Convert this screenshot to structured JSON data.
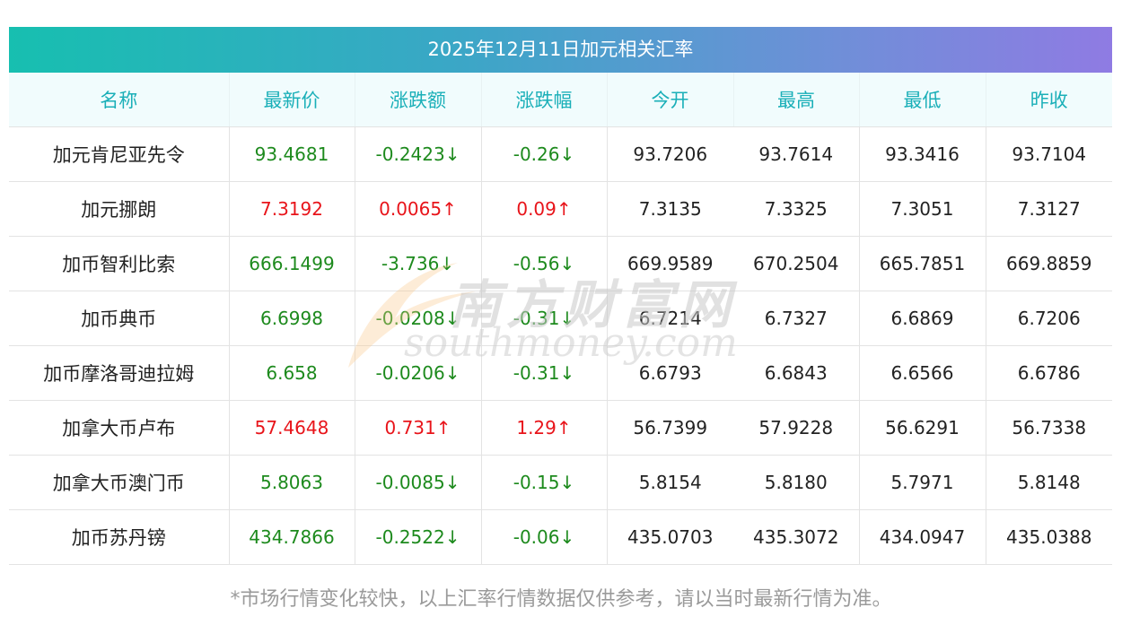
{
  "table": {
    "title": "2025年12月11日加元相关汇率",
    "headers": [
      "名称",
      "最新价",
      "涨跌额",
      "涨跌幅",
      "今开",
      "最高",
      "最低",
      "昨收"
    ],
    "rows": [
      {
        "name": "加元肯尼亚先令",
        "latest": "93.4681",
        "change": "-0.2423↓",
        "pct": "-0.26↓",
        "open": "93.7206",
        "high": "93.7614",
        "low": "93.3416",
        "prev": "93.7104",
        "direction": "down"
      },
      {
        "name": "加元挪朗",
        "latest": "7.3192",
        "change": "0.0065↑",
        "pct": "0.09↑",
        "open": "7.3135",
        "high": "7.3325",
        "low": "7.3051",
        "prev": "7.3127",
        "direction": "up"
      },
      {
        "name": "加币智利比索",
        "latest": "666.1499",
        "change": "-3.736↓",
        "pct": "-0.56↓",
        "open": "669.9589",
        "high": "670.2504",
        "low": "665.7851",
        "prev": "669.8859",
        "direction": "down"
      },
      {
        "name": "加币典币",
        "latest": "6.6998",
        "change": "-0.0208↓",
        "pct": "-0.31↓",
        "open": "6.7214",
        "high": "6.7327",
        "low": "6.6869",
        "prev": "6.7206",
        "direction": "down"
      },
      {
        "name": "加币摩洛哥迪拉姆",
        "latest": "6.658",
        "change": "-0.0206↓",
        "pct": "-0.31↓",
        "open": "6.6793",
        "high": "6.6843",
        "low": "6.6566",
        "prev": "6.6786",
        "direction": "down"
      },
      {
        "name": "加拿大币卢布",
        "latest": "57.4648",
        "change": "0.731↑",
        "pct": "1.29↑",
        "open": "56.7399",
        "high": "57.9228",
        "low": "56.6291",
        "prev": "56.7338",
        "direction": "up"
      },
      {
        "name": "加拿大币澳门币",
        "latest": "5.8063",
        "change": "-0.0085↓",
        "pct": "-0.15↓",
        "open": "5.8154",
        "high": "5.8180",
        "low": "5.7971",
        "prev": "5.8148",
        "direction": "down"
      },
      {
        "name": "加币苏丹镑",
        "latest": "434.7866",
        "change": "-0.2522↓",
        "pct": "-0.06↓",
        "open": "435.0703",
        "high": "435.3072",
        "low": "434.0947",
        "prev": "435.0388",
        "direction": "down"
      }
    ]
  },
  "watermark": {
    "cn": "南方财富网",
    "en": "southmoney.com"
  },
  "footnote": "*市场行情变化较快，以上汇率行情数据仅供参考，请以当时最新行情为准。",
  "colors": {
    "up": "#e8141a",
    "down": "#1d8a1d",
    "header_text": "#1aafb8",
    "title_gradient_start": "#17bfb0",
    "title_gradient_end": "#8f7be3"
  }
}
